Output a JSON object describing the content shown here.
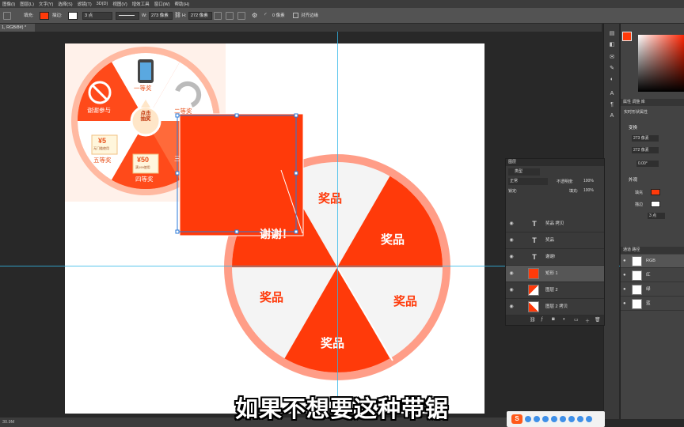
{
  "menu": [
    "图像(I)",
    "图层(L)",
    "文字(Y)",
    "选择(S)",
    "滤镜(T)",
    "3D(D)",
    "视图(V)",
    "增效工具",
    "窗口(W)",
    "帮助(H)"
  ],
  "options": {
    "fill_label": "填充:",
    "stroke_label": "描边:",
    "stroke_width": "3 点",
    "w_label": "W:",
    "w_value": "273 像素",
    "h_label": "H:",
    "h_value": "272 像素",
    "radius_value": "0 像素",
    "align_edges": "对齐边缘",
    "fill_color": "#ff3a0a"
  },
  "document_tab": "1, RGB/8#) *",
  "status_text": "30.9M",
  "wheel_small": {
    "center_label_line1": "点击",
    "center_label_line2": "抽奖",
    "labels": [
      "谢谢参与",
      "一等奖",
      "二等奖",
      "五等奖",
      "四等奖",
      "三"
    ],
    "coupon_5_value": "¥5",
    "coupon_5_sub": "无门槛使用",
    "coupon_50_value": "¥50",
    "coupon_50_sub": "满199使用"
  },
  "wheel_big": {
    "segments": [
      "奖品",
      "奖品",
      "奖品",
      "奖品",
      "奖品",
      "谢谢！"
    ],
    "accent_color": "#ff3a0a",
    "rim_color": "#ff9d87",
    "light_color": "#f4f4f4"
  },
  "layers_panel": {
    "tab_label": "图层",
    "kind_label": "类型",
    "blend_mode": "正常",
    "opacity_label": "不透明度:",
    "opacity_value": "100%",
    "lock_label": "锁定:",
    "fill_label": "填充:",
    "fill_value": "100%",
    "rows": [
      {
        "type": "text",
        "name": "奖品 拷贝"
      },
      {
        "type": "text",
        "name": "奖品"
      },
      {
        "type": "text",
        "name": "谢谢!"
      },
      {
        "type": "shape",
        "name": "矩形 1"
      },
      {
        "type": "image",
        "name": "图层 2"
      },
      {
        "type": "image",
        "name": "图层 2 拷贝"
      }
    ]
  },
  "properties_panel": {
    "tabs": "属性  调整  库",
    "kind": "实时形状属性",
    "section_transform": "变换",
    "w_value": "273 像素",
    "h_value": "272 像素",
    "angle_value": "0.00°",
    "section_appearance": "外观",
    "fill_label": "填充",
    "stroke_label": "描边",
    "stroke_width": "3 点"
  },
  "channels_panel": {
    "tabs": "通道  路径",
    "channels": [
      "RGB",
      "红",
      "绿",
      "蓝"
    ]
  },
  "subtitle": "如果不想要这种带锯",
  "taskbar_ime": "S"
}
